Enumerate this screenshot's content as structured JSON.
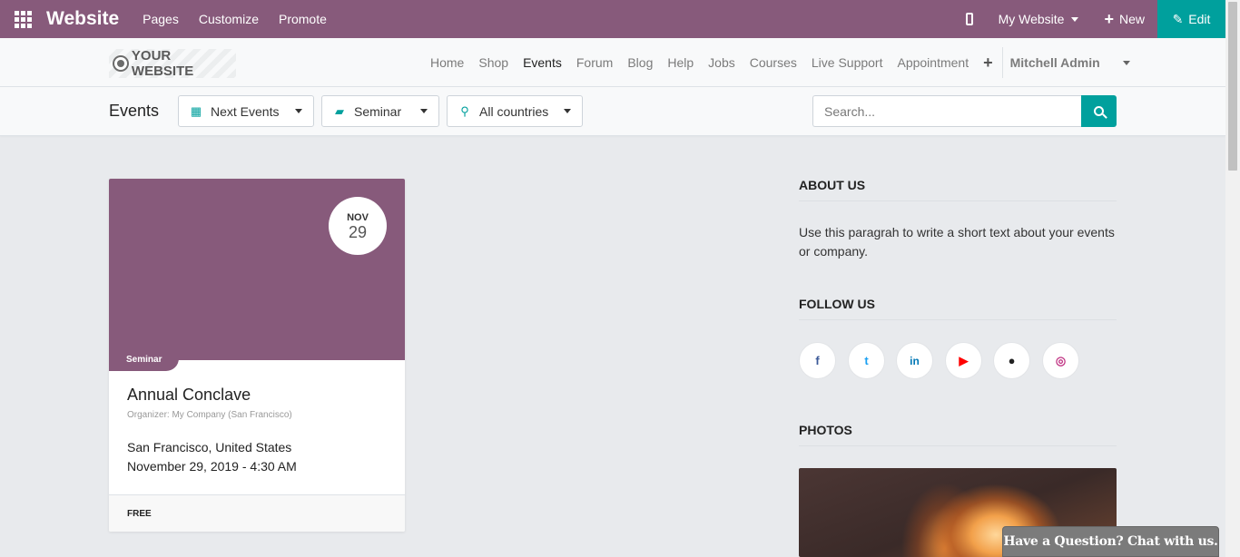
{
  "topbar": {
    "brand": "Website",
    "menu": [
      "Pages",
      "Customize",
      "Promote"
    ],
    "site_selector": "My Website",
    "new_label": "New",
    "edit_label": "Edit",
    "color": "#875a7b",
    "edit_color": "#00a09d"
  },
  "sitenav": {
    "logo_text": "YOUR WEBSITE",
    "links": [
      "Home",
      "Shop",
      "Events",
      "Forum",
      "Blog",
      "Help",
      "Jobs",
      "Courses",
      "Live Support",
      "Appointment"
    ],
    "active": "Events",
    "user": "Mitchell Admin"
  },
  "filters": {
    "title": "Events",
    "date_filter": "Next Events",
    "type_filter": "Seminar",
    "country_filter": "All countries",
    "search_placeholder": "Search..."
  },
  "event": {
    "month": "NOV",
    "day": "29",
    "tag": "Seminar",
    "title": "Annual Conclave",
    "organizer": "Organizer: My Company (San Francisco)",
    "location": "San Francisco, United States",
    "datetime": "November 29, 2019 - 4:30 AM",
    "price": "FREE"
  },
  "sidebar": {
    "about_title": "ABOUT US",
    "about_text": "Use this paragrah to write a short text about your events or company.",
    "follow_title": "FOLLOW US",
    "social": [
      {
        "icon": "facebook-icon",
        "glyph": "f",
        "color": "#3b5998"
      },
      {
        "icon": "twitter-icon",
        "glyph": "t",
        "color": "#1da1f2"
      },
      {
        "icon": "linkedin-icon",
        "glyph": "in",
        "color": "#0077b5"
      },
      {
        "icon": "youtube-icon",
        "glyph": "▶",
        "color": "#ff0000"
      },
      {
        "icon": "github-icon",
        "glyph": "●",
        "color": "#222222"
      },
      {
        "icon": "instagram-icon",
        "glyph": "◎",
        "color": "#c13584"
      }
    ],
    "photos_title": "PHOTOS"
  },
  "livechat": {
    "label": "Have a Question? Chat with us."
  }
}
